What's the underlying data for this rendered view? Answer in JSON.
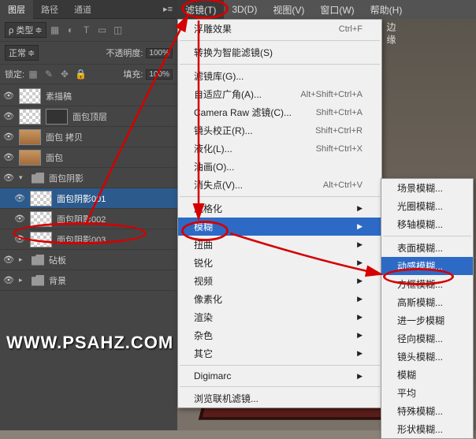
{
  "menubar": {
    "items": [
      "滤镜(T)",
      "3D(D)",
      "视图(V)",
      "窗口(W)",
      "帮助(H)"
    ],
    "active_index": 0
  },
  "panel": {
    "tabs": [
      "图层",
      "路径",
      "通道"
    ],
    "kind": "ρ 类型",
    "blend_mode": "正常",
    "opacity_label": "不透明度:",
    "opacity_value": "100%",
    "lock_label": "锁定:",
    "fill_label": "填充:",
    "fill_value": "100%"
  },
  "layers": [
    {
      "name": "素描稿",
      "indent": 0,
      "thumb": "checker",
      "eye": true
    },
    {
      "name": "面包顶层",
      "indent": 0,
      "thumb": "checker",
      "eye": true,
      "mask": true
    },
    {
      "name": "面包 拷贝",
      "indent": 0,
      "thumb": "bread",
      "eye": true
    },
    {
      "name": "面包",
      "indent": 0,
      "thumb": "bread",
      "eye": true
    },
    {
      "name": "面包阴影",
      "indent": 0,
      "folder": true,
      "eye": true,
      "open": true
    },
    {
      "name": "面包阴影001",
      "indent": 1,
      "thumb": "checker",
      "eye": true,
      "selected": true
    },
    {
      "name": "面包阴影002",
      "indent": 1,
      "thumb": "checker",
      "eye": true
    },
    {
      "name": "面包阴影003",
      "indent": 1,
      "thumb": "checker",
      "eye": true
    },
    {
      "name": "砧板",
      "indent": 0,
      "folder": true,
      "eye": true
    },
    {
      "name": "背景",
      "indent": 0,
      "folder": true,
      "eye": true
    }
  ],
  "menu1": [
    {
      "label": "浮雕效果",
      "shortcut": "Ctrl+F"
    },
    {
      "sep": true
    },
    {
      "label": "转换为智能滤镜(S)"
    },
    {
      "sep": true
    },
    {
      "label": "滤镜库(G)..."
    },
    {
      "label": "自适应广角(A)...",
      "shortcut": "Alt+Shift+Ctrl+A"
    },
    {
      "label": "Camera Raw 滤镜(C)...",
      "shortcut": "Shift+Ctrl+A"
    },
    {
      "label": "镜头校正(R)...",
      "shortcut": "Shift+Ctrl+R"
    },
    {
      "label": "液化(L)...",
      "shortcut": "Shift+Ctrl+X"
    },
    {
      "label": "油画(O)..."
    },
    {
      "label": "消失点(V)...",
      "shortcut": "Alt+Ctrl+V"
    },
    {
      "sep": true
    },
    {
      "label": "风格化",
      "sub": true
    },
    {
      "label": "模糊",
      "sub": true,
      "highlighted": true
    },
    {
      "label": "扭曲",
      "sub": true
    },
    {
      "label": "锐化",
      "sub": true
    },
    {
      "label": "视频",
      "sub": true
    },
    {
      "label": "像素化",
      "sub": true
    },
    {
      "label": "渲染",
      "sub": true
    },
    {
      "label": "杂色",
      "sub": true
    },
    {
      "label": "其它",
      "sub": true
    },
    {
      "sep": true
    },
    {
      "label": "Digimarc",
      "sub": true
    },
    {
      "sep": true
    },
    {
      "label": "浏览联机滤镜..."
    }
  ],
  "menu2": [
    {
      "label": "场景模糊..."
    },
    {
      "label": "光圈模糊..."
    },
    {
      "label": "移轴模糊..."
    },
    {
      "sep": true
    },
    {
      "label": "表面模糊..."
    },
    {
      "label": "动感模糊...",
      "highlighted": true
    },
    {
      "label": "方框模糊..."
    },
    {
      "label": "高斯模糊..."
    },
    {
      "label": "进一步模糊"
    },
    {
      "label": "径向模糊..."
    },
    {
      "label": "镜头模糊..."
    },
    {
      "label": "模糊"
    },
    {
      "label": "平均"
    },
    {
      "label": "特殊模糊..."
    },
    {
      "label": "形状模糊..."
    }
  ],
  "watermark": "WWW.PSAHZ.COM",
  "sidetext": "边缘"
}
